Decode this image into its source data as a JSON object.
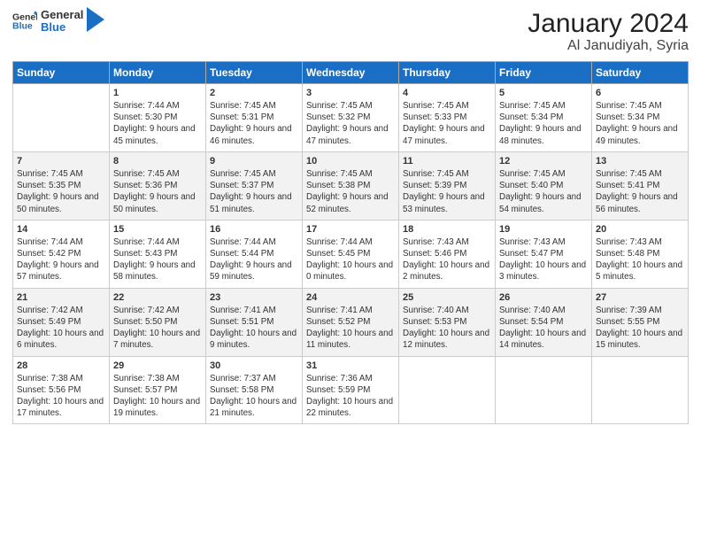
{
  "header": {
    "logo_general": "General",
    "logo_blue": "Blue",
    "month_title": "January 2024",
    "location": "Al Janudiyah, Syria"
  },
  "days_of_week": [
    "Sunday",
    "Monday",
    "Tuesday",
    "Wednesday",
    "Thursday",
    "Friday",
    "Saturday"
  ],
  "weeks": [
    [
      {
        "day": "",
        "sunrise": "",
        "sunset": "",
        "daylight": ""
      },
      {
        "day": "1",
        "sunrise": "Sunrise: 7:44 AM",
        "sunset": "Sunset: 5:30 PM",
        "daylight": "Daylight: 9 hours and 45 minutes."
      },
      {
        "day": "2",
        "sunrise": "Sunrise: 7:45 AM",
        "sunset": "Sunset: 5:31 PM",
        "daylight": "Daylight: 9 hours and 46 minutes."
      },
      {
        "day": "3",
        "sunrise": "Sunrise: 7:45 AM",
        "sunset": "Sunset: 5:32 PM",
        "daylight": "Daylight: 9 hours and 47 minutes."
      },
      {
        "day": "4",
        "sunrise": "Sunrise: 7:45 AM",
        "sunset": "Sunset: 5:33 PM",
        "daylight": "Daylight: 9 hours and 47 minutes."
      },
      {
        "day": "5",
        "sunrise": "Sunrise: 7:45 AM",
        "sunset": "Sunset: 5:34 PM",
        "daylight": "Daylight: 9 hours and 48 minutes."
      },
      {
        "day": "6",
        "sunrise": "Sunrise: 7:45 AM",
        "sunset": "Sunset: 5:34 PM",
        "daylight": "Daylight: 9 hours and 49 minutes."
      }
    ],
    [
      {
        "day": "7",
        "sunrise": "Sunrise: 7:45 AM",
        "sunset": "Sunset: 5:35 PM",
        "daylight": "Daylight: 9 hours and 50 minutes."
      },
      {
        "day": "8",
        "sunrise": "Sunrise: 7:45 AM",
        "sunset": "Sunset: 5:36 PM",
        "daylight": "Daylight: 9 hours and 50 minutes."
      },
      {
        "day": "9",
        "sunrise": "Sunrise: 7:45 AM",
        "sunset": "Sunset: 5:37 PM",
        "daylight": "Daylight: 9 hours and 51 minutes."
      },
      {
        "day": "10",
        "sunrise": "Sunrise: 7:45 AM",
        "sunset": "Sunset: 5:38 PM",
        "daylight": "Daylight: 9 hours and 52 minutes."
      },
      {
        "day": "11",
        "sunrise": "Sunrise: 7:45 AM",
        "sunset": "Sunset: 5:39 PM",
        "daylight": "Daylight: 9 hours and 53 minutes."
      },
      {
        "day": "12",
        "sunrise": "Sunrise: 7:45 AM",
        "sunset": "Sunset: 5:40 PM",
        "daylight": "Daylight: 9 hours and 54 minutes."
      },
      {
        "day": "13",
        "sunrise": "Sunrise: 7:45 AM",
        "sunset": "Sunset: 5:41 PM",
        "daylight": "Daylight: 9 hours and 56 minutes."
      }
    ],
    [
      {
        "day": "14",
        "sunrise": "Sunrise: 7:44 AM",
        "sunset": "Sunset: 5:42 PM",
        "daylight": "Daylight: 9 hours and 57 minutes."
      },
      {
        "day": "15",
        "sunrise": "Sunrise: 7:44 AM",
        "sunset": "Sunset: 5:43 PM",
        "daylight": "Daylight: 9 hours and 58 minutes."
      },
      {
        "day": "16",
        "sunrise": "Sunrise: 7:44 AM",
        "sunset": "Sunset: 5:44 PM",
        "daylight": "Daylight: 9 hours and 59 minutes."
      },
      {
        "day": "17",
        "sunrise": "Sunrise: 7:44 AM",
        "sunset": "Sunset: 5:45 PM",
        "daylight": "Daylight: 10 hours and 0 minutes."
      },
      {
        "day": "18",
        "sunrise": "Sunrise: 7:43 AM",
        "sunset": "Sunset: 5:46 PM",
        "daylight": "Daylight: 10 hours and 2 minutes."
      },
      {
        "day": "19",
        "sunrise": "Sunrise: 7:43 AM",
        "sunset": "Sunset: 5:47 PM",
        "daylight": "Daylight: 10 hours and 3 minutes."
      },
      {
        "day": "20",
        "sunrise": "Sunrise: 7:43 AM",
        "sunset": "Sunset: 5:48 PM",
        "daylight": "Daylight: 10 hours and 5 minutes."
      }
    ],
    [
      {
        "day": "21",
        "sunrise": "Sunrise: 7:42 AM",
        "sunset": "Sunset: 5:49 PM",
        "daylight": "Daylight: 10 hours and 6 minutes."
      },
      {
        "day": "22",
        "sunrise": "Sunrise: 7:42 AM",
        "sunset": "Sunset: 5:50 PM",
        "daylight": "Daylight: 10 hours and 7 minutes."
      },
      {
        "day": "23",
        "sunrise": "Sunrise: 7:41 AM",
        "sunset": "Sunset: 5:51 PM",
        "daylight": "Daylight: 10 hours and 9 minutes."
      },
      {
        "day": "24",
        "sunrise": "Sunrise: 7:41 AM",
        "sunset": "Sunset: 5:52 PM",
        "daylight": "Daylight: 10 hours and 11 minutes."
      },
      {
        "day": "25",
        "sunrise": "Sunrise: 7:40 AM",
        "sunset": "Sunset: 5:53 PM",
        "daylight": "Daylight: 10 hours and 12 minutes."
      },
      {
        "day": "26",
        "sunrise": "Sunrise: 7:40 AM",
        "sunset": "Sunset: 5:54 PM",
        "daylight": "Daylight: 10 hours and 14 minutes."
      },
      {
        "day": "27",
        "sunrise": "Sunrise: 7:39 AM",
        "sunset": "Sunset: 5:55 PM",
        "daylight": "Daylight: 10 hours and 15 minutes."
      }
    ],
    [
      {
        "day": "28",
        "sunrise": "Sunrise: 7:38 AM",
        "sunset": "Sunset: 5:56 PM",
        "daylight": "Daylight: 10 hours and 17 minutes."
      },
      {
        "day": "29",
        "sunrise": "Sunrise: 7:38 AM",
        "sunset": "Sunset: 5:57 PM",
        "daylight": "Daylight: 10 hours and 19 minutes."
      },
      {
        "day": "30",
        "sunrise": "Sunrise: 7:37 AM",
        "sunset": "Sunset: 5:58 PM",
        "daylight": "Daylight: 10 hours and 21 minutes."
      },
      {
        "day": "31",
        "sunrise": "Sunrise: 7:36 AM",
        "sunset": "Sunset: 5:59 PM",
        "daylight": "Daylight: 10 hours and 22 minutes."
      },
      {
        "day": "",
        "sunrise": "",
        "sunset": "",
        "daylight": ""
      },
      {
        "day": "",
        "sunrise": "",
        "sunset": "",
        "daylight": ""
      },
      {
        "day": "",
        "sunrise": "",
        "sunset": "",
        "daylight": ""
      }
    ]
  ]
}
